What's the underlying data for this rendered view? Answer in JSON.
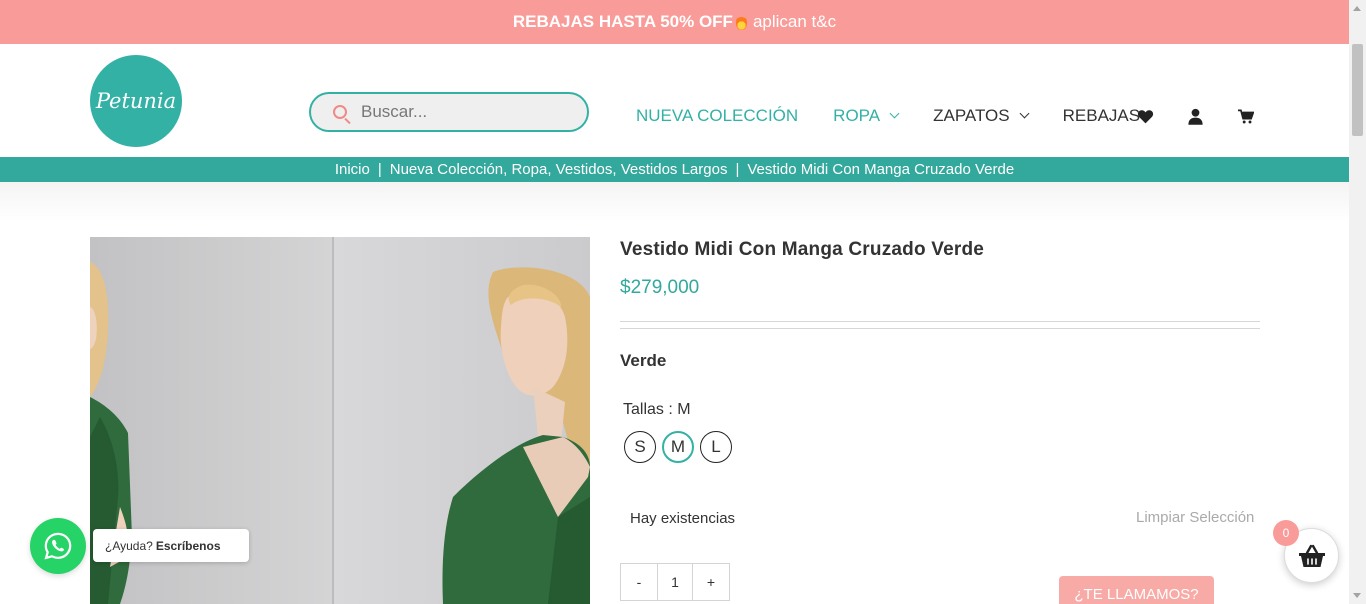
{
  "promo": {
    "bold": "REBAJAS HASTA 50% OFF",
    "rest": "aplican t&c",
    "icon": "flame-icon"
  },
  "brand": {
    "logo_text": "Petunia",
    "color": "#33b1a5"
  },
  "search": {
    "placeholder": "Buscar...",
    "value": ""
  },
  "nav": {
    "items": [
      {
        "label": "NUEVA COLECCIÓN",
        "has_dropdown": false
      },
      {
        "label": "ROPA",
        "has_dropdown": true
      },
      {
        "label": "ZAPATOS",
        "has_dropdown": true
      },
      {
        "label": "REBAJAS",
        "has_dropdown": false
      }
    ],
    "icons": [
      "heart-icon",
      "user-icon",
      "cart-icon"
    ]
  },
  "breadcrumb": {
    "items": [
      "Inicio",
      "Nueva Colección, Ropa, Vestidos, Vestidos Largos",
      "Vestido Midi Con Manga Cruzado Verde"
    ],
    "separator": "|"
  },
  "product": {
    "title": "Vestido Midi Con Manga Cruzado Verde",
    "price": "$279,000",
    "color": "Verde",
    "sizes_label": "Tallas : M",
    "sizes": [
      "S",
      "M",
      "L"
    ],
    "selected_size": "M",
    "stock": "Hay existencias",
    "clear_label": "Limpiar Selección",
    "quantity": "1",
    "minus": "-",
    "plus": "+"
  },
  "call_button": "¿TE LLAMAMOS?",
  "whatsapp": {
    "prefix": "¿Ayuda?",
    "bold": "Escríbenos"
  },
  "cart": {
    "count": "0"
  },
  "colors": {
    "accent": "#33b1a5",
    "promo": "#f99b98",
    "breadcrumb": "#33a89c",
    "whatsapp": "#25d366"
  }
}
